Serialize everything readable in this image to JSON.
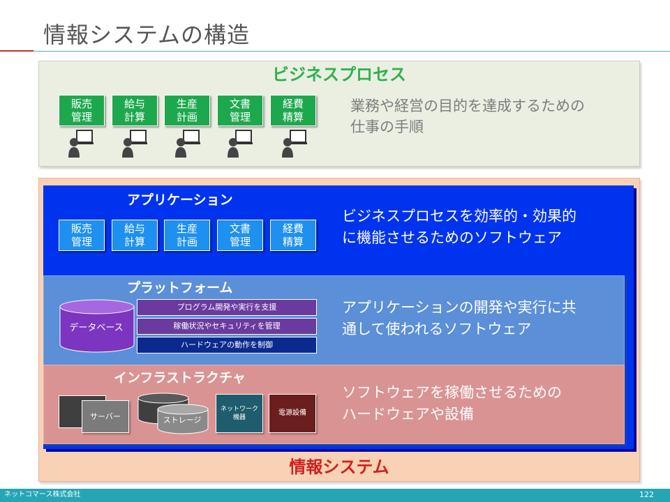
{
  "title": "情報システムの構造",
  "business_process": {
    "title": "ビジネスプロセス",
    "tasks": [
      {
        "line1": "販売",
        "line2": "管理"
      },
      {
        "line1": "給与",
        "line2": "計算"
      },
      {
        "line1": "生産",
        "line2": "計画"
      },
      {
        "line1": "文書",
        "line2": "管理"
      },
      {
        "line1": "経費",
        "line2": "精算"
      }
    ],
    "desc_line1": "業務や経営の目的を達成するための",
    "desc_line2": "仕事の手順",
    "icon": "person-with-laptop-icon",
    "color": "#2db24a"
  },
  "information_system": {
    "title": "情報システム",
    "title_color": "#d02020",
    "application": {
      "title": "アプリケーション",
      "apps": [
        {
          "line1": "販売",
          "line2": "管理"
        },
        {
          "line1": "給与",
          "line2": "計算"
        },
        {
          "line1": "生産",
          "line2": "計画"
        },
        {
          "line1": "文書",
          "line2": "管理"
        },
        {
          "line1": "経費",
          "line2": "精算"
        }
      ],
      "desc_line1": "ビジネスプロセスを効率的・効果的",
      "desc_line2": "に機能させるためのソフトウェア",
      "color": "#0033ee"
    },
    "platform": {
      "title": "プラットフォーム",
      "database": "データベース",
      "functions": [
        "プログラム開発や実行を支援",
        "稼働状況やセキュリティを管理",
        "ハードウェアの動作を制御"
      ],
      "desc_line1": "アプリケーションの開発や実行に共",
      "desc_line2": "通して使われるソフトウェア",
      "color": "#5b8fd8"
    },
    "infrastructure": {
      "title": "インフラストラクチャ",
      "server": "サーバー",
      "storage": "ストレージ",
      "network_line1": "ネットワーク",
      "network_line2": "機器",
      "power": "電源設備",
      "desc_line1": "ソフトウェアを稼働させるための",
      "desc_line2": "ハードウェアや設備",
      "color": "#da9393"
    }
  },
  "footer": {
    "company": "ネットコマース株式会社",
    "page": "122"
  }
}
